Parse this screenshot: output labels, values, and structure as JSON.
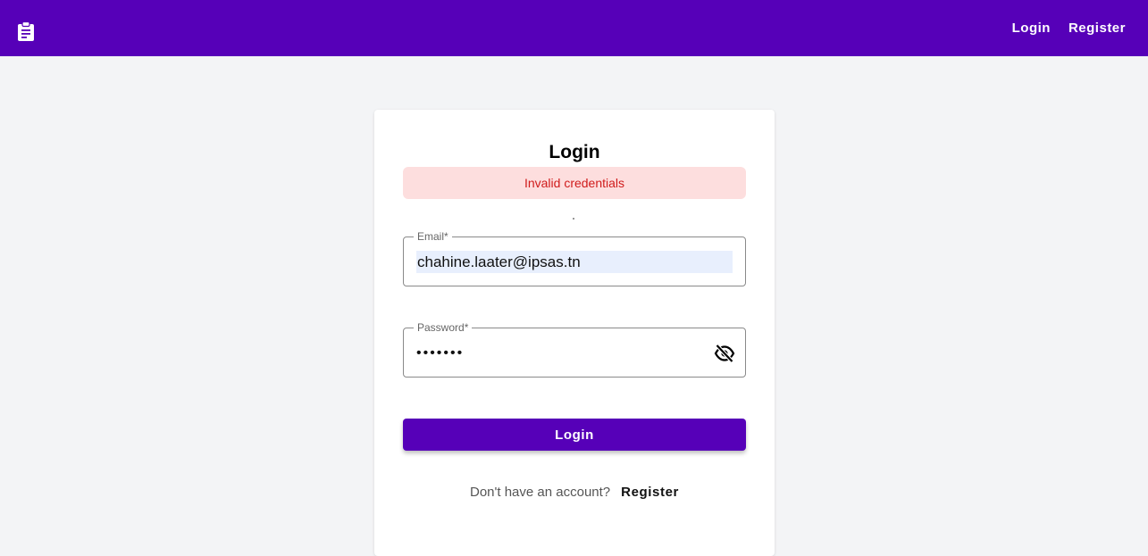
{
  "appbar": {
    "logo_icon": "clipboard-icon",
    "nav": {
      "login_label": "Login",
      "register_label": "Register"
    },
    "background_color": "#5600b8"
  },
  "login_card": {
    "title": "Login",
    "alert": {
      "message": "Invalid credentials",
      "background_color": "#fddede",
      "text_color": "#d01c1c"
    },
    "email": {
      "label": "Email*",
      "value": "chahine.laater@ipsas.tn"
    },
    "password": {
      "label": "Password*",
      "value": "•••••••",
      "toggle_icon": "eye-off-icon"
    },
    "submit_label": "Login",
    "footer": {
      "prompt": "Don't have an account?",
      "register_link": "Register"
    }
  }
}
